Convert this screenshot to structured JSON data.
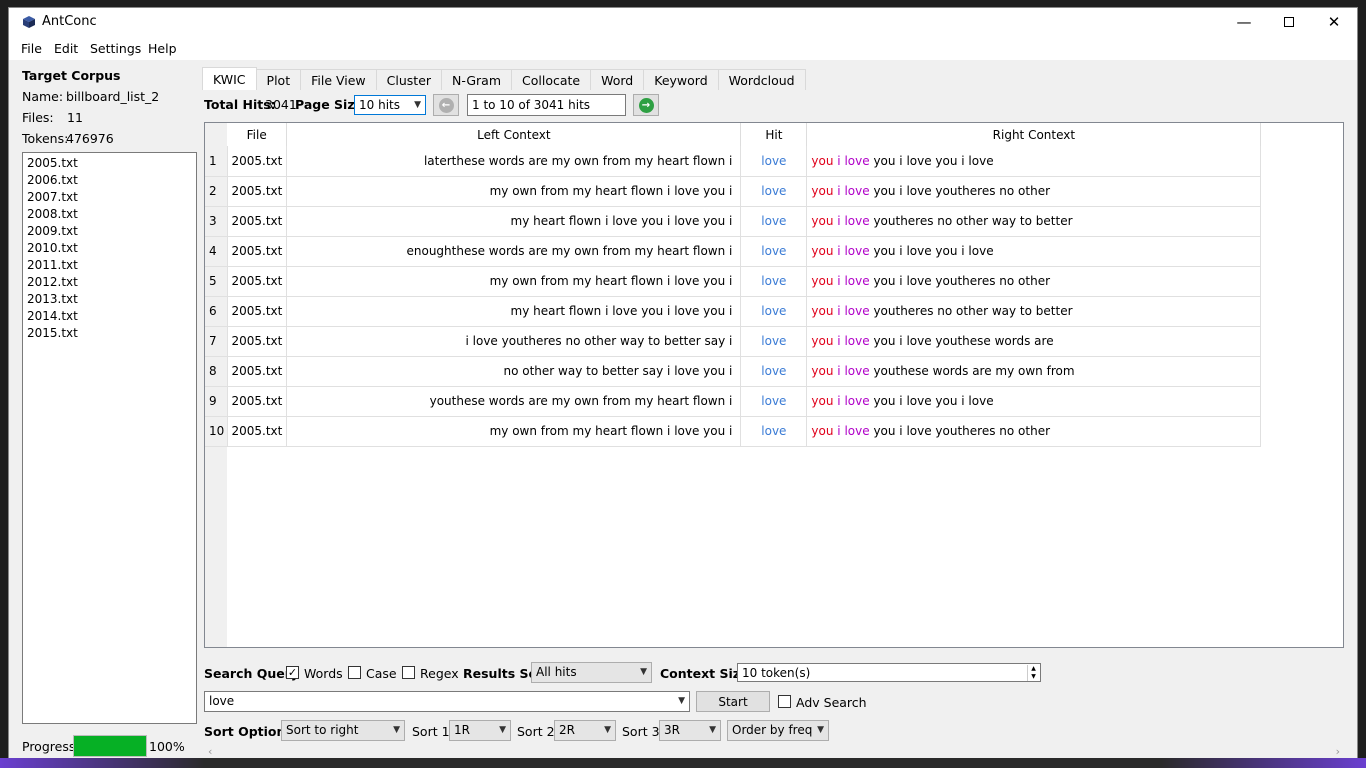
{
  "window": {
    "title": "AntConc"
  },
  "menu": [
    "File",
    "Edit",
    "Settings",
    "Help"
  ],
  "corpus": {
    "heading": "Target Corpus",
    "name_label": "Name:",
    "name": "billboard_list_2",
    "files_label": "Files:",
    "files": "11",
    "tokens_label": "Tokens:",
    "tokens": "476976",
    "file_list": [
      "2005.txt",
      "2006.txt",
      "2007.txt",
      "2008.txt",
      "2009.txt",
      "2010.txt",
      "2011.txt",
      "2012.txt",
      "2013.txt",
      "2014.txt",
      "2015.txt"
    ]
  },
  "progress": {
    "label": "Progress",
    "percent": 100,
    "text": "100%"
  },
  "tabs": [
    "KWIC",
    "Plot",
    "File View",
    "Cluster",
    "N-Gram",
    "Collocate",
    "Word",
    "Keyword",
    "Wordcloud"
  ],
  "active_tab": "KWIC",
  "hits_bar": {
    "total_hits_label": "Total Hits:",
    "total_hits": "3041",
    "page_size_label": "Page Size",
    "page_size": "10 hits",
    "range": "1 to 10 of 3041 hits"
  },
  "table": {
    "headers": [
      "File",
      "Left Context",
      "Hit",
      "Right Context"
    ],
    "rows": [
      {
        "n": "1",
        "file": "2005.txt",
        "left": "laterthese words are my own from my heart flown i",
        "hit": "love",
        "r1": "you",
        "r2": "i",
        "r3": "love",
        "rest": "you i love you i love"
      },
      {
        "n": "2",
        "file": "2005.txt",
        "left": "my own from my heart flown i love you i",
        "hit": "love",
        "r1": "you",
        "r2": "i",
        "r3": "love",
        "rest": "you i love youtheres no other"
      },
      {
        "n": "3",
        "file": "2005.txt",
        "left": "my heart flown i love you i love you i",
        "hit": "love",
        "r1": "you",
        "r2": "i",
        "r3": "love",
        "rest": "youtheres no other way to better"
      },
      {
        "n": "4",
        "file": "2005.txt",
        "left": "enoughthese words are my own from my heart flown i",
        "hit": "love",
        "r1": "you",
        "r2": "i",
        "r3": "love",
        "rest": "you i love you i love"
      },
      {
        "n": "5",
        "file": "2005.txt",
        "left": "my own from my heart flown i love you i",
        "hit": "love",
        "r1": "you",
        "r2": "i",
        "r3": "love",
        "rest": "you i love youtheres no other"
      },
      {
        "n": "6",
        "file": "2005.txt",
        "left": "my heart flown i love you i love you i",
        "hit": "love",
        "r1": "you",
        "r2": "i",
        "r3": "love",
        "rest": "youtheres no other way to better"
      },
      {
        "n": "7",
        "file": "2005.txt",
        "left": "i love youtheres no other way to better say i",
        "hit": "love",
        "r1": "you",
        "r2": "i",
        "r3": "love",
        "rest": "you i love youthese words are"
      },
      {
        "n": "8",
        "file": "2005.txt",
        "left": "no other way to better say i love you i",
        "hit": "love",
        "r1": "you",
        "r2": "i",
        "r3": "love",
        "rest": "youthese words are my own from"
      },
      {
        "n": "9",
        "file": "2005.txt",
        "left": "youthese words are my own from my heart flown i",
        "hit": "love",
        "r1": "you",
        "r2": "i",
        "r3": "love",
        "rest": "you i love you i love"
      },
      {
        "n": "10",
        "file": "2005.txt",
        "left": "my own from my heart flown i love you i",
        "hit": "love",
        "r1": "you",
        "r2": "i",
        "r3": "love",
        "rest": "you i love youtheres no other"
      }
    ]
  },
  "search": {
    "query_label": "Search Query",
    "words_label": "Words",
    "words_checked": true,
    "case_label": "Case",
    "case_checked": false,
    "regex_label": "Regex",
    "regex_checked": false,
    "results_set_label": "Results Set",
    "results_set": "All hits",
    "context_size_label": "Context Size",
    "context_size": "10 token(s)",
    "query": "love",
    "start_label": "Start",
    "adv_label": "Adv Search",
    "adv_checked": false
  },
  "sort": {
    "label": "Sort Options",
    "mode": "Sort to right",
    "sort1_label": "Sort 1",
    "sort1": "1R",
    "sort2_label": "Sort 2",
    "sort2": "2R",
    "sort3_label": "Sort 3",
    "sort3": "3R",
    "order": "Order by freq"
  },
  "colors": {
    "progress": "#06b025",
    "hit": "#3a7bd5",
    "r1": "#e0001b",
    "r2": "#b000c8"
  }
}
